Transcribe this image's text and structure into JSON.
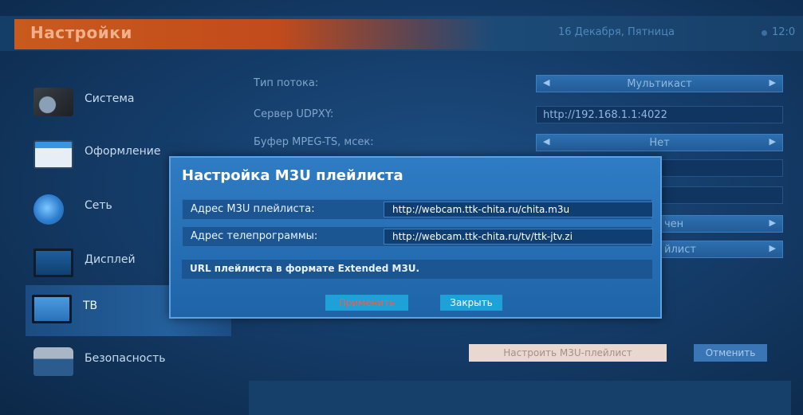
{
  "header": {
    "title": "Настройки",
    "date": "16 Декабря, Пятница",
    "time": "12:0"
  },
  "sidebar": {
    "items": [
      {
        "label": "Система",
        "icon": "gear-icon"
      },
      {
        "label": "Оформление",
        "icon": "window-icon"
      },
      {
        "label": "Сеть",
        "icon": "globe-icon"
      },
      {
        "label": "Дисплей",
        "icon": "monitor-icon"
      },
      {
        "label": "ТВ",
        "icon": "tv-icon",
        "active": true
      },
      {
        "label": "Безопасность",
        "icon": "lock-icon"
      }
    ]
  },
  "settings": {
    "stream_type_label": "Тип потока:",
    "stream_type_value": "Мультикаст",
    "udpxy_label": "Сервер UDPXY:",
    "udpxy_value": "http://192.168.1.1:4022",
    "buffer_label": "Буфер MPEG-TS, мсек:",
    "buffer_value": "Нет",
    "row5_partial": "чен",
    "row6_partial": "йлист"
  },
  "buttons": {
    "configure_m3u": "Настроить M3U-плейлист",
    "cancel": "Отменить"
  },
  "modal": {
    "title": "Настройка M3U плейлиста",
    "playlist_label": "Адрес M3U плейлиста:",
    "playlist_value": "http://webcam.ttk-chita.ru/chita.m3u",
    "epg_label": "Адрес телепрограммы:",
    "epg_value": "http://webcam.ttk-chita.ru/tv/ttk-jtv.zi",
    "hint": "URL плейлиста в формате Extended M3U.",
    "apply": "Применить",
    "close": "Закрыть"
  },
  "colors": {
    "accent_title_bar": "#c85a1e",
    "modal_bg": "#2f7cc4",
    "apply_text": "#ff5a3c"
  }
}
